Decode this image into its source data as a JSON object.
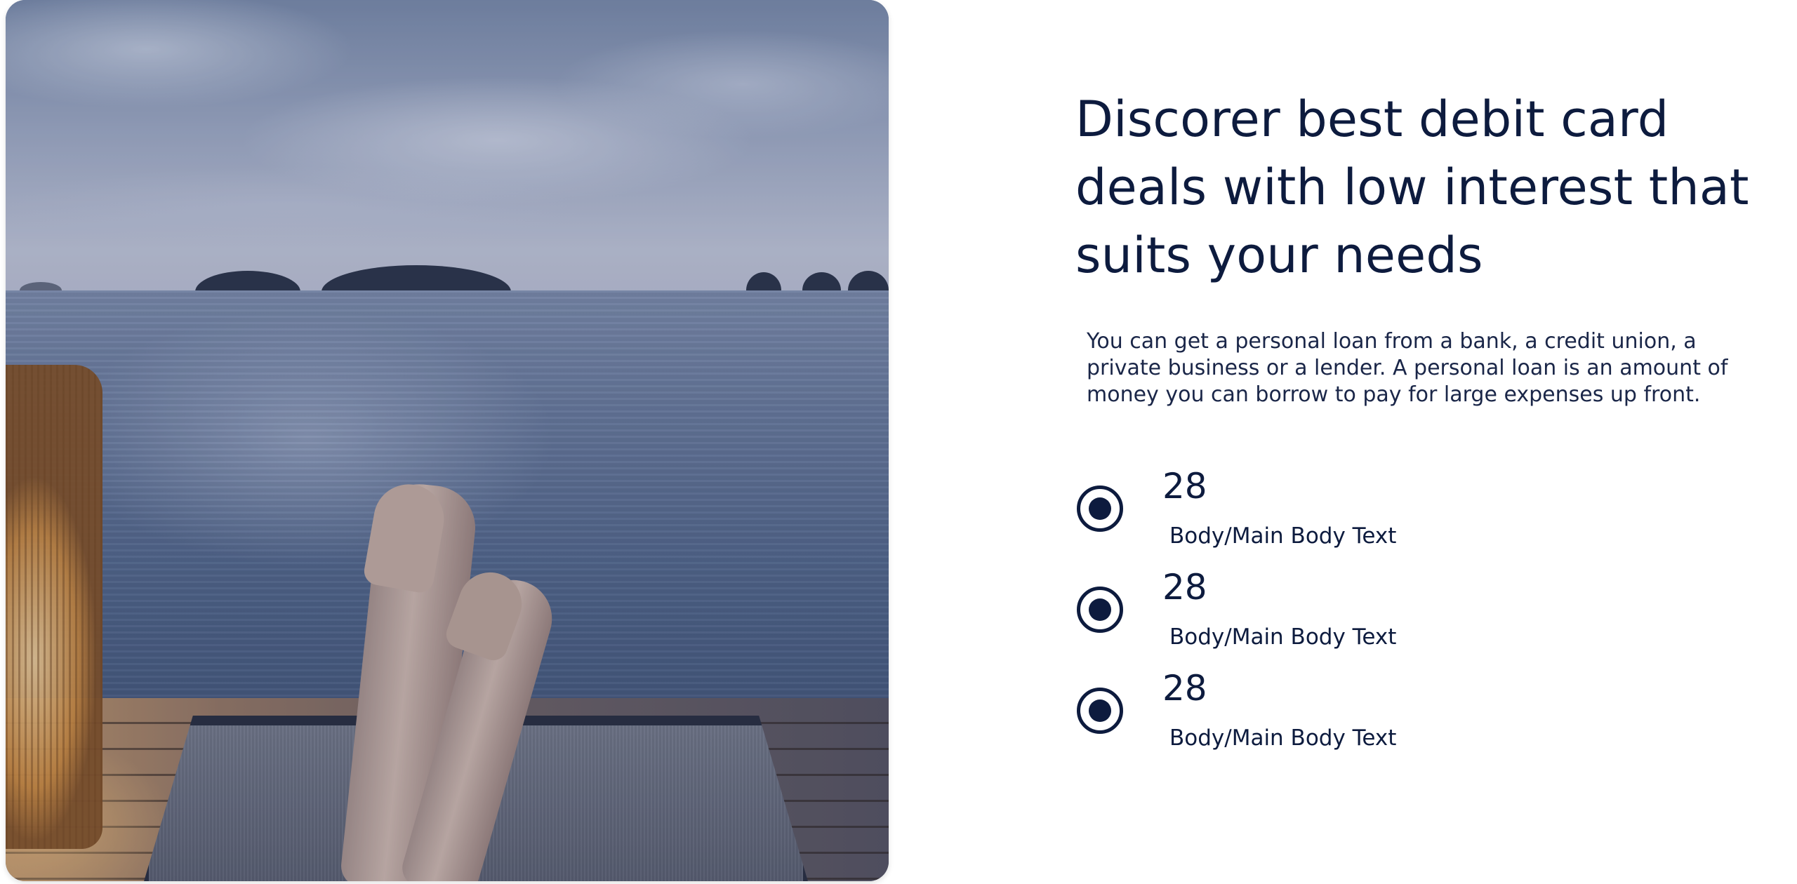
{
  "hero": {
    "image_alt": "Legs resting on a lounger on a wooden dock overlooking the sea at dusk"
  },
  "content": {
    "headline_lines": [
      "Discorer best debit card",
      "deals with low interest that",
      "suits your needs"
    ],
    "description_lines": [
      "You can get a personal loan from a bank, a credit union, a",
      "private business or a lender. A personal loan is an amount of",
      "money you can borrow to pay for large expenses up front."
    ],
    "stats": [
      {
        "value": "28",
        "label": "Body/Main Body Text",
        "icon": "radio-selected-icon"
      },
      {
        "value": "28",
        "label": "Body/Main Body Text",
        "icon": "radio-selected-icon"
      },
      {
        "value": "28",
        "label": "Body/Main Body Text",
        "icon": "radio-selected-icon"
      }
    ]
  },
  "colors": {
    "text_primary": "#0d1b3e",
    "background": "#ffffff"
  }
}
